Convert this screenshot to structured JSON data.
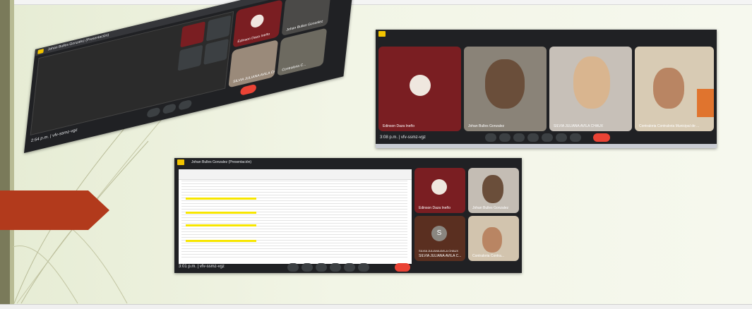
{
  "window1": {
    "title": "Johan Bulles Gonzalez (Presentación)",
    "time": "2:54 p.m.",
    "meeting_code": "vfv-ssmz-vgz",
    "tiles": [
      {
        "name": "Edinson Daza Ineño"
      },
      {
        "name": "Johan Bulles Gonzalez"
      },
      {
        "name": "SILVIA JULIANA AVILA CH."
      },
      {
        "name": "Contraloria C..."
      }
    ]
  },
  "window2": {
    "time": "3:08 p.m.",
    "meeting_code": "vfv-ssmz-vgz",
    "tiles": [
      {
        "name": "Edinson Daza Ineño"
      },
      {
        "name": "Johan Bulles Gonzalez"
      },
      {
        "name": "SILVIA JULIANA AVILA CHAUX"
      },
      {
        "name": "Contraloria Contraloria Municipal de ..."
      }
    ]
  },
  "window3": {
    "title": "Johan Bulles Gonzalez (Presentación)",
    "time": "3:01 p.m.",
    "meeting_code": "vfv-ssmz-vgz",
    "avatar_letter": "S",
    "tiles": [
      {
        "name": "Edinson Daza Ineño"
      },
      {
        "name": "Johan Bulles Gonzalez"
      },
      {
        "name": "SILVIA JULIANA AVILA C..."
      },
      {
        "name": "Contraloria Contra..."
      }
    ],
    "sub_label": "SILVIA JULIANA AVILA CHAUX"
  },
  "colors": {
    "meet_bg": "#202124",
    "tile_red": "#7a1e22",
    "end_call": "#ea4335",
    "arrow": "#b23a1c"
  }
}
